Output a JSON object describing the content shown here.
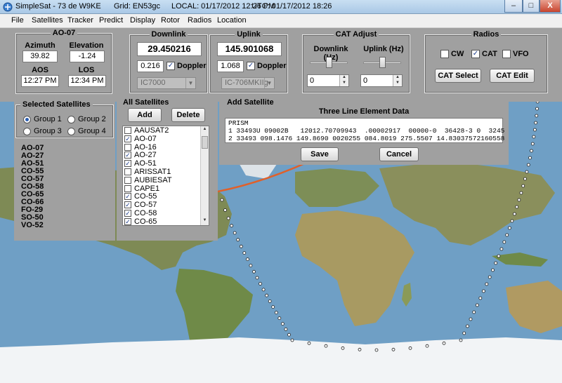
{
  "titlebar": {
    "app_name": "SimpleSat - 73 de W9KE",
    "grid": "Grid: EN53gc",
    "local": "LOCAL: 01/17/2012 12:26 PM",
    "utc": "UTC: 01/17/2012 18:26",
    "minimize": "–",
    "maximize": "□",
    "close": "X"
  },
  "menu": [
    "File",
    "Satellites",
    "Tracker",
    "Predict",
    "Display",
    "Rotor",
    "Radios",
    "Location"
  ],
  "sat_info": {
    "title": "AO-07",
    "azimuth_label": "Azimuth",
    "azimuth": "39.82",
    "elevation_label": "Elevation",
    "elevation": "-1.24",
    "aos_label": "AOS",
    "aos": "12:27 PM",
    "los_label": "LOS",
    "los": "12:34 PM"
  },
  "downlink": {
    "title": "Downlink",
    "frequency": "29.450216",
    "offset": "0.216",
    "doppler_label": "Doppler",
    "doppler_checked": true,
    "radio": "IC7000"
  },
  "uplink": {
    "title": "Uplink",
    "frequency": "145.901068",
    "offset": "1.068",
    "doppler_label": "Doppler",
    "doppler_checked": true,
    "radio": "IC-706MKIIg"
  },
  "cat_adjust": {
    "title": "CAT Adjust",
    "downlink_label": "Downlink (Hz)",
    "uplink_label": "Uplink (Hz)",
    "downlink_value": "0",
    "uplink_value": "0",
    "downlink_slider": 0.5,
    "uplink_slider": 0.5
  },
  "radios": {
    "title": "Radios",
    "cw_label": "CW",
    "cw_checked": false,
    "cat_label": "CAT",
    "cat_checked": true,
    "vfo_label": "VFO",
    "vfo_checked": false,
    "cat_select": "CAT Select",
    "cat_edit": "CAT Edit"
  },
  "selected_satellites": {
    "title": "Selected Satellites",
    "groups": [
      {
        "label": "Group 1",
        "selected": true
      },
      {
        "label": "Group 2",
        "selected": false
      },
      {
        "label": "Group 3",
        "selected": false
      },
      {
        "label": "Group 4",
        "selected": false
      }
    ],
    "list": [
      "AO-07",
      "AO-27",
      "AO-51",
      "CO-55",
      "CO-57",
      "CO-58",
      "CO-65",
      "CO-66",
      "FO-29",
      "SO-50",
      "VO-52"
    ]
  },
  "all_satellites": {
    "title": "All Satellites",
    "add": "Add",
    "delete": "Delete",
    "list": [
      {
        "name": "AAUSAT2",
        "checked": false
      },
      {
        "name": "AO-07",
        "checked": true
      },
      {
        "name": "AO-16",
        "checked": false
      },
      {
        "name": "AO-27",
        "checked": true
      },
      {
        "name": "AO-51",
        "checked": true
      },
      {
        "name": "ARISSAT1",
        "checked": false
      },
      {
        "name": "AUBIESAT",
        "checked": false
      },
      {
        "name": "CAPE1",
        "checked": false
      },
      {
        "name": "CO-55",
        "checked": true
      },
      {
        "name": "CO-57",
        "checked": true
      },
      {
        "name": "CO-58",
        "checked": true
      },
      {
        "name": "CO-65",
        "checked": true
      }
    ]
  },
  "add_satellite": {
    "title": "Add Satellite",
    "tle_title": "Three Line Element Data",
    "tle": [
      "PRISM",
      "1 33493U 09002B   12012.70709943  .00002917  00000-0  36428-3 0  3245",
      "2 33493 098.1476 149.8690 0020255 084.8019 275.5507 14.83037572160558"
    ],
    "save": "Save",
    "cancel": "Cancel"
  },
  "colors": {
    "panel": "#a0a0a0",
    "ocean": "#6fa3c9",
    "land": "#8c9a5e",
    "ice": "#f4f6f8",
    "track": "#e0602a"
  },
  "icons": {
    "app": "satellite-icon",
    "check": "check-icon"
  }
}
